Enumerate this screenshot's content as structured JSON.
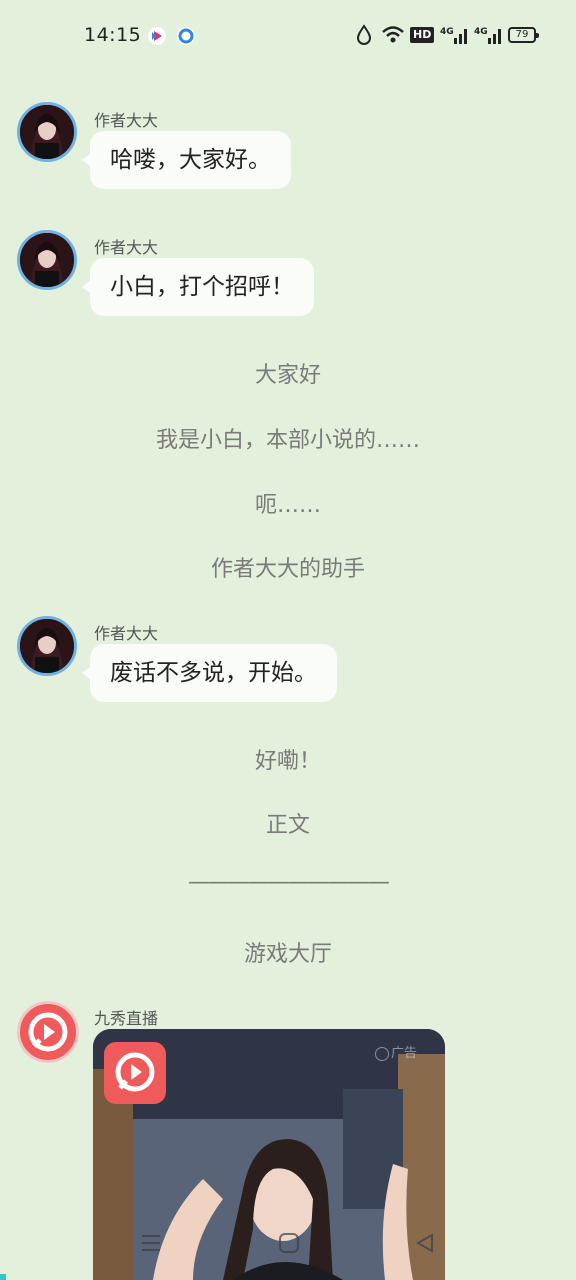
{
  "status_bar": {
    "time": "14:15",
    "battery": "79",
    "hd_label": "HD",
    "net_label_1": "4G",
    "net_label_2": "4G"
  },
  "messages": [
    {
      "author": "作者大大",
      "text": "哈喽，大家好。"
    },
    {
      "author": "作者大大",
      "text": "小白，打个招呼！"
    },
    {
      "author": "作者大大",
      "text": "废话不多说，开始。"
    }
  ],
  "narration": [
    "大家好",
    "我是小白，本部小说的……",
    "呃……",
    "作者大大的助手",
    "好嘞！",
    "正文",
    "——————————",
    "游戏大厅"
  ],
  "ad": {
    "author": "九秀直播",
    "tag": "广告"
  },
  "colors": {
    "background": "#e3f1dc",
    "bubble": "#fafcf8",
    "avatar_ring": "#6fb1e3",
    "ad_red": "#ef5a5a"
  }
}
